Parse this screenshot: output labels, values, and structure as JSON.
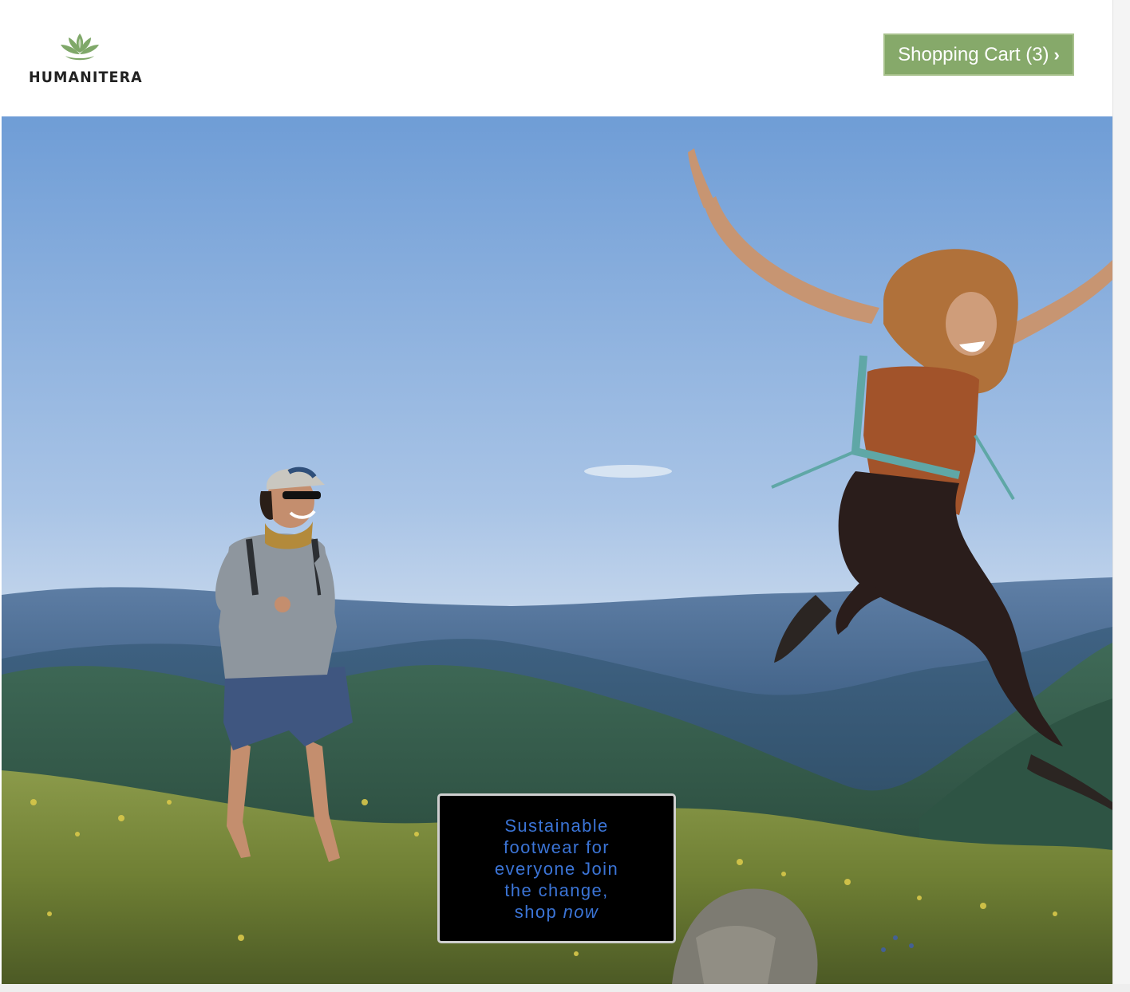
{
  "brand": {
    "name": "HUMANITERA",
    "logo_icon": "lotus-icon",
    "logo_color": "#7fa869"
  },
  "header": {
    "cart_button": {
      "label": "Shopping Cart (3)",
      "chevron": "›",
      "icon": "chevron-right-icon",
      "background": "#86a96a"
    }
  },
  "hero": {
    "image_description_icon": "hero-photo",
    "cta": {
      "text_main": "Sustainable footwear for everyone Join the change, shop",
      "text_emphasis": "now",
      "text_color": "#3b74d6",
      "background": "#000000"
    }
  }
}
